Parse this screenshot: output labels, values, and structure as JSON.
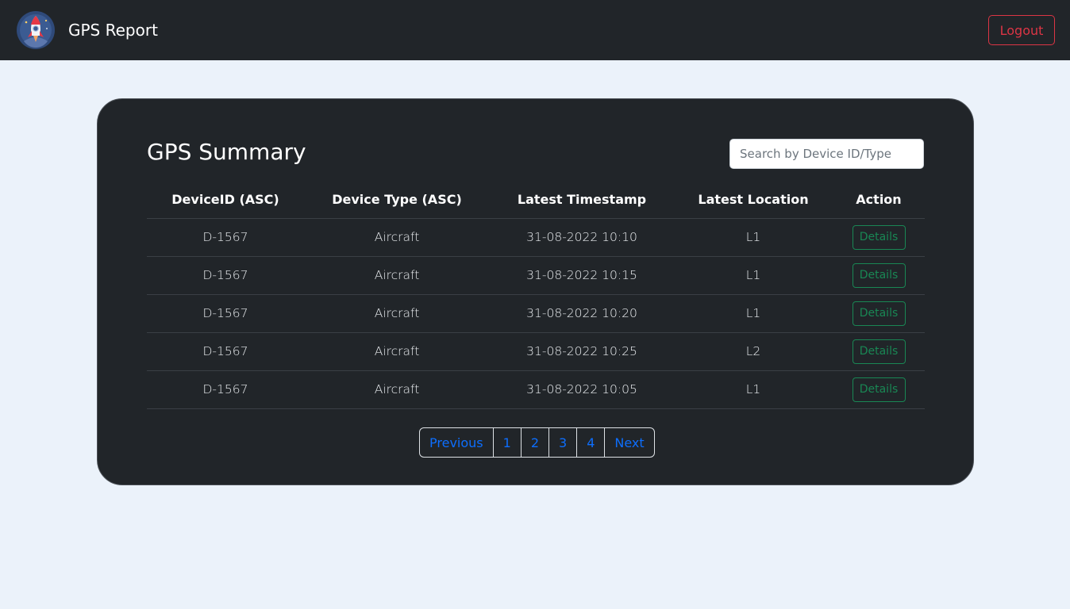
{
  "navbar": {
    "title": "GPS Report",
    "logout_label": "Logout"
  },
  "summary": {
    "title": "GPS Summary",
    "search_placeholder": "Search by Device ID/Type"
  },
  "table": {
    "headers": [
      "DeviceID (ASC)",
      "Device Type (ASC)",
      "Latest Timestamp",
      "Latest Location",
      "Action"
    ],
    "rows": [
      {
        "device_id": "D-1567",
        "device_type": "Aircraft",
        "timestamp": "31-08-2022 10:10",
        "location": "L1",
        "action": "Details"
      },
      {
        "device_id": "D-1567",
        "device_type": "Aircraft",
        "timestamp": "31-08-2022 10:15",
        "location": "L1",
        "action": "Details"
      },
      {
        "device_id": "D-1567",
        "device_type": "Aircraft",
        "timestamp": "31-08-2022 10:20",
        "location": "L1",
        "action": "Details"
      },
      {
        "device_id": "D-1567",
        "device_type": "Aircraft",
        "timestamp": "31-08-2022 10:25",
        "location": "L2",
        "action": "Details"
      },
      {
        "device_id": "D-1567",
        "device_type": "Aircraft",
        "timestamp": "31-08-2022 10:05",
        "location": "L1",
        "action": "Details"
      }
    ]
  },
  "pagination": {
    "previous_label": "Previous",
    "pages": [
      "1",
      "2",
      "3",
      "4"
    ],
    "next_label": "Next"
  },
  "colors": {
    "navbar_bg": "#212529",
    "page_bg": "#ebf2fa",
    "danger": "#dc3545",
    "success": "#198754",
    "link": "#0d6efd"
  },
  "icons": {
    "logo": "rocket-icon"
  }
}
